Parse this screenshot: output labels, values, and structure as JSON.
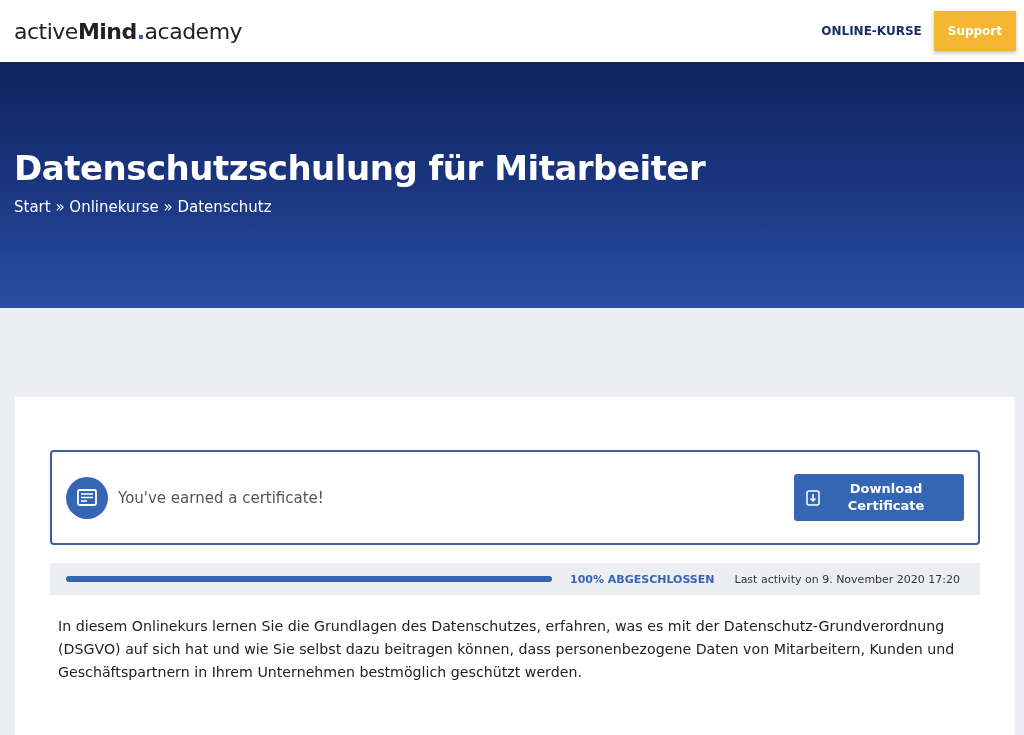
{
  "header": {
    "logo": {
      "part_1": "active",
      "part_2": "Mind",
      "dot": ".",
      "part_3": "academy"
    },
    "nav": [
      {
        "label": "ONLINE-KURSE",
        "kind": "link"
      },
      {
        "label": "Support",
        "kind": "button"
      }
    ]
  },
  "hero": {
    "title": "Datenschutzschulung für Mitarbeiter",
    "breadcrumb": "Start » Onlinekurse » Datenschutz"
  },
  "certificate": {
    "message": "You've earned a certificate!",
    "button": "Download Certificate"
  },
  "progress": {
    "level": 1,
    "label": "100% ABGESCHLOSSEN",
    "last_activity": "Last activity on 9. November 2020 17:20"
  },
  "description": "In diesem Onlinekurs lernen Sie die Grundlagen des Datenschutzes, erfahren, was es mit der Datenschutz-Grundverordnung (DSGVO) auf sich hat und wie Sie selbst dazu beitragen können, dass personenbezogene Daten von Mitarbeitern, Kunden und Geschäftspartnern in Ihrem Unternehmen bestmöglich geschützt werden."
}
